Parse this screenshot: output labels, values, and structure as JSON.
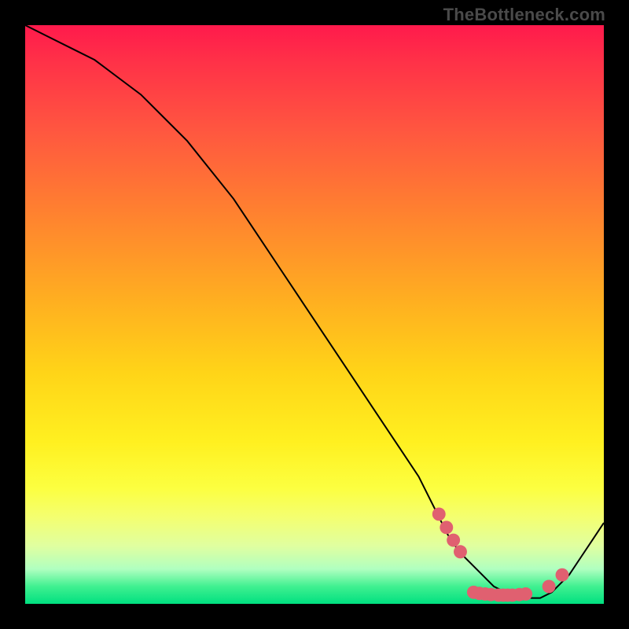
{
  "attribution": "TheBottleneck.com",
  "chart_data": {
    "type": "line",
    "title": "",
    "xlabel": "",
    "ylabel": "",
    "xlim": [
      0,
      100
    ],
    "ylim": [
      0,
      100
    ],
    "series": [
      {
        "name": "curve",
        "x": [
          0,
          4,
          8,
          12,
          16,
          20,
          24,
          28,
          32,
          36,
          40,
          44,
          48,
          52,
          56,
          60,
          64,
          68,
          71,
          73,
          75,
          77,
          79,
          81,
          83,
          85,
          87,
          89,
          91,
          92,
          94,
          96,
          98,
          100
        ],
        "y": [
          100,
          98,
          96,
          94,
          91,
          88,
          84,
          80,
          75,
          70,
          64,
          58,
          52,
          46,
          40,
          34,
          28,
          22,
          16,
          12,
          9,
          7,
          5,
          3,
          2,
          1,
          1,
          1,
          2,
          3,
          5,
          8,
          11,
          14
        ]
      }
    ],
    "markers": {
      "name": "dots",
      "color": "#e06070",
      "x": [
        71.5,
        72.8,
        74.0,
        75.2,
        77.5,
        78.5,
        79.5,
        80.5,
        81.8,
        82.6,
        83.4,
        84.2,
        85.4,
        86.5,
        90.5,
        92.8
      ],
      "y": [
        15.5,
        13.2,
        11.0,
        9.0,
        2.0,
        1.8,
        1.7,
        1.6,
        1.5,
        1.5,
        1.5,
        1.5,
        1.6,
        1.7,
        3.0,
        5.0
      ]
    }
  }
}
